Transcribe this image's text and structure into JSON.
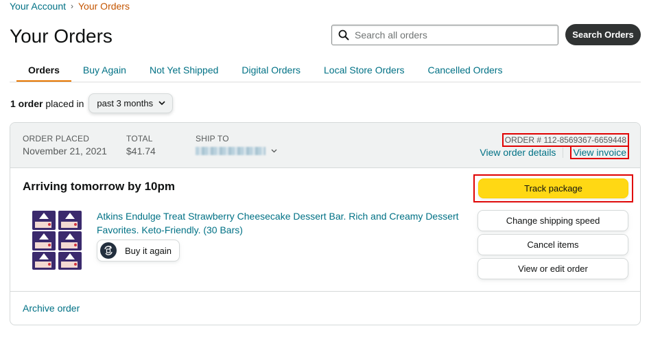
{
  "breadcrumb": {
    "account": "Your Account",
    "separator": "›",
    "current": "Your Orders"
  },
  "page_title": "Your Orders",
  "search": {
    "placeholder": "Search all orders",
    "value": "",
    "button_label": "Search Orders"
  },
  "tabs": [
    {
      "label": "Orders",
      "active": true
    },
    {
      "label": "Buy Again",
      "active": false
    },
    {
      "label": "Not Yet Shipped",
      "active": false
    },
    {
      "label": "Digital Orders",
      "active": false
    },
    {
      "label": "Local Store Orders",
      "active": false
    },
    {
      "label": "Cancelled Orders",
      "active": false
    }
  ],
  "filter": {
    "count_text": "1 order",
    "placed_in_text": "placed in",
    "period": "past 3 months"
  },
  "order": {
    "placed_label": "ORDER PLACED",
    "placed_date": "November 21, 2021",
    "total_label": "TOTAL",
    "total": "$41.74",
    "ship_to_label": "SHIP TO",
    "order_number": "ORDER # 112-8569367-6659448",
    "view_details": "View order details",
    "view_invoice": "View invoice",
    "arrival": "Arriving tomorrow by 10pm",
    "product_title": "Atkins Endulge Treat Strawberry Cheesecake Dessert Bar. Rich and Creamy Dessert Favorites. Keto-Friendly. (30 Bars)",
    "buy_again": "Buy it again",
    "actions": {
      "track": "Track package",
      "change_speed": "Change shipping speed",
      "cancel": "Cancel items",
      "view_edit": "View or edit order"
    },
    "archive": "Archive order"
  },
  "colors": {
    "link": "#007185",
    "breadcrumb_current": "#c45500",
    "tab_underline": "#e77600",
    "track_button": "#ffd814",
    "highlight_box": "#e00000",
    "search_button": "#303333"
  },
  "icons": [
    "search-icon",
    "chevron-down-icon",
    "buy-again-icon",
    "product-thumbnail"
  ]
}
